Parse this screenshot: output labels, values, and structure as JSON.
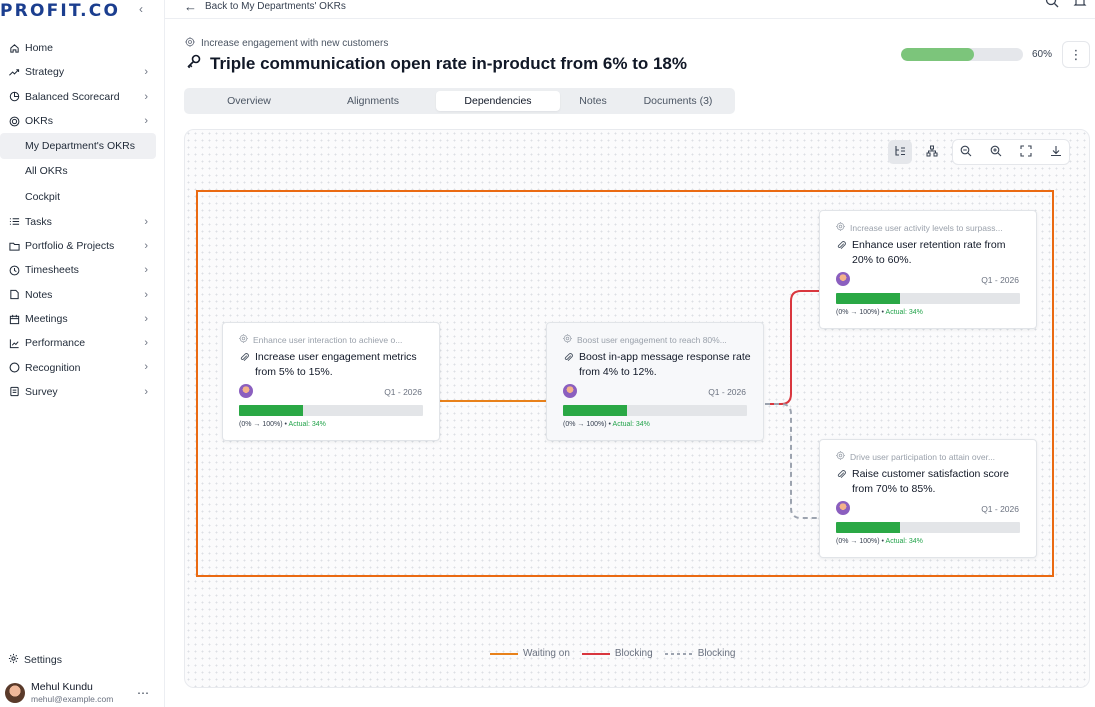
{
  "brand": {
    "logo": "PROFIT.CO"
  },
  "sidebar": {
    "items": [
      {
        "label": "Home",
        "icon": "home-icon"
      },
      {
        "label": "Strategy",
        "icon": "strategy-icon"
      },
      {
        "label": "Balanced Scorecard",
        "icon": "scorecard-icon"
      },
      {
        "label": "OKRs",
        "icon": "target-icon"
      },
      {
        "label": "My Department's OKRs"
      },
      {
        "label": "All OKRs"
      },
      {
        "label": "Cockpit"
      },
      {
        "label": "Tasks",
        "icon": "tasks-icon"
      },
      {
        "label": "Portfolio & Projects",
        "icon": "folder-icon"
      },
      {
        "label": "Timesheets",
        "icon": "clock-icon"
      },
      {
        "label": "Notes",
        "icon": "note-icon"
      },
      {
        "label": "Meetings",
        "icon": "calendar-icon"
      },
      {
        "label": "Performance",
        "icon": "chart-icon"
      },
      {
        "label": "Recognition",
        "icon": "circle-icon"
      },
      {
        "label": "Survey",
        "icon": "survey-icon"
      }
    ],
    "settings": "Settings",
    "user": {
      "name": "Mehul Kundu",
      "email": "mehul@example.com"
    }
  },
  "topbar": {
    "back_label": "Back to My Departments' OKRs"
  },
  "header": {
    "parent_objective": "Increase engagement with new customers",
    "title": "Triple communication open rate in-product from 6% to 18%",
    "progress": 0.6,
    "progress_label": "60%"
  },
  "tabs": [
    {
      "label": "Overview"
    },
    {
      "label": "Alignments"
    },
    {
      "label": "Dependencies",
      "active": true
    },
    {
      "label": "Notes"
    },
    {
      "label": "Documents (3)"
    }
  ],
  "cards": [
    {
      "parent": "Enhance user interaction to achieve o...",
      "name": "Increase user engagement metrics from 5% to 15%.",
      "period": "Q1 - 2026",
      "progress": 0.35,
      "range": "(0% → 100%) • ",
      "actual": "Actual: 34%"
    },
    {
      "parent": "Boost user engagement to reach 80%...",
      "name": "Boost in-app message response rate from 4% to 12%.",
      "period": "Q1 - 2026",
      "progress": 0.35,
      "range": "(0% → 100%) • ",
      "actual": "Actual: 34%"
    },
    {
      "parent": "Increase user activity levels to surpass...",
      "name": "Enhance user retention rate from 20% to 60%.",
      "period": "Q1 - 2026",
      "progress": 0.35,
      "range": "(0% → 100%) • ",
      "actual": "Actual: 34%"
    },
    {
      "parent": "Drive user participation to attain over...",
      "name": "Raise customer satisfaction score from 70% to 85%.",
      "period": "Q1 - 2026",
      "progress": 0.35,
      "range": "(0% → 100%) • ",
      "actual": "Actual: 34%"
    }
  ],
  "legend": [
    {
      "label": "Waiting on",
      "color": "#e8811a",
      "style": "solid"
    },
    {
      "label": "Blocking",
      "color": "#d9363e",
      "style": "solid"
    },
    {
      "label": "Blocking",
      "color": "#9ca3af",
      "style": "dashed"
    }
  ],
  "colors": {
    "brand": "#1b3e8f",
    "highlight": "#ea6a12",
    "progress": "#2aa845",
    "header_progress": "#7cc57b"
  }
}
